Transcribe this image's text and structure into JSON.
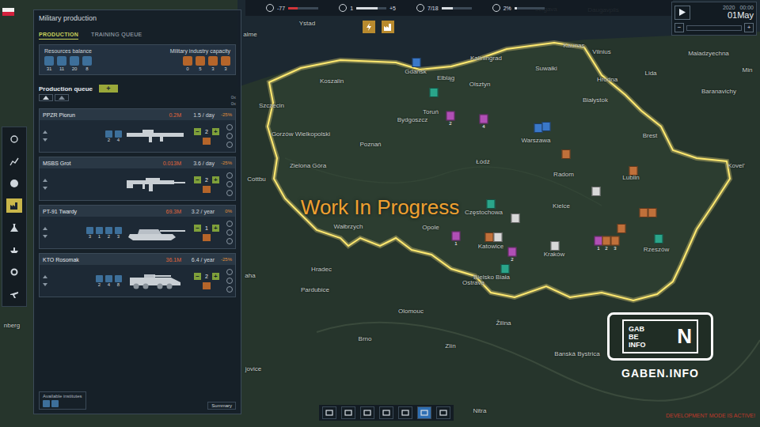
{
  "top_bar": {
    "stats": [
      {
        "label": "-77",
        "level": 0.3,
        "color": "#d0353a"
      },
      {
        "label": "1",
        "delta": "+5",
        "level": 0.72,
        "color": "#d8dde2"
      },
      {
        "label": "7/18",
        "level": 0.39,
        "color": "#d8dde2"
      },
      {
        "label": "2%",
        "level": 0.08,
        "color": "#d8dde2"
      }
    ]
  },
  "date": {
    "year": "2020",
    "time": "00:00",
    "day": "01May",
    "minus": "−",
    "plus": "+",
    "speed_level": 0
  },
  "sidebar": [
    {
      "selected": false
    },
    {
      "selected": false
    },
    {
      "selected": false
    },
    {
      "selected": true
    },
    {
      "selected": false
    },
    {
      "selected": false
    },
    {
      "selected": false
    },
    {
      "selected": false
    }
  ],
  "panel": {
    "title": "Military production",
    "tabs": [
      {
        "label": "PRODUCTION",
        "selected": true
      },
      {
        "label": "TRAINING QUEUE",
        "selected": false
      }
    ],
    "resources": {
      "title": "Resources balance",
      "values": [
        "31",
        "11",
        "20",
        "8"
      ]
    },
    "capacity": {
      "title": "Military industry capacity",
      "values": [
        "0",
        "5",
        "3",
        "3"
      ]
    },
    "queue": {
      "title": "Production queue",
      "add": "+",
      "counts": [
        "0x",
        "0x"
      ]
    },
    "items": [
      {
        "name": "PPZR Piorun",
        "kind": "launcher",
        "cost": "0.2M",
        "rate": "1.5 / day",
        "modifier": "-25%",
        "requirements": [
          "2",
          "4"
        ],
        "quantity": "2",
        "minus": "−",
        "plus": "+"
      },
      {
        "name": "MSBS Grot",
        "kind": "rifle",
        "cost": "0.013M",
        "rate": "3.6 / day",
        "modifier": "-25%",
        "requirements": [],
        "quantity": "2",
        "minus": "−",
        "plus": "+"
      },
      {
        "name": "PT-91 Twardy",
        "kind": "tank",
        "cost": "69.3M",
        "rate": "3.2 / year",
        "modifier": "0%",
        "requirements": [
          "3",
          "1",
          "2",
          "3"
        ],
        "quantity": "1",
        "minus": "−",
        "plus": "+"
      },
      {
        "name": "KTO Rosomak",
        "kind": "apc",
        "cost": "36.1M",
        "rate": "6.4 / year",
        "modifier": "-25%",
        "requirements": [
          "2",
          "4",
          "8"
        ],
        "quantity": "2",
        "minus": "−",
        "plus": "+"
      }
    ],
    "institutes": "Available institutes",
    "summary": "Summary"
  },
  "map": {
    "cities": [
      "Ystad",
      "Jelgava",
      "Daugavpils",
      "Kaliningrad",
      "Kaunas",
      "Vilnius",
      "Maladzyechna",
      "alme",
      "Min",
      "Gdańsk",
      "Elbląg",
      "Olsztyn",
      "Suwałki",
      "Hrodna",
      "Lida",
      "Baranavichy",
      "Koszalin",
      "Białystok",
      "Szczecin",
      "Bydgoszcz",
      "Toruń",
      "Gorzów Wielkopolski",
      "Poznań",
      "Warszawa",
      "Brest",
      "Kovel'",
      "Łódź",
      "Zielona Góra",
      "Radom",
      "Lublin",
      "Cottbu",
      "Kielce",
      "Częstochowa",
      "Opole",
      "Wałbrzych",
      "Katowice",
      "Kraków",
      "Rzeszów",
      "Hradec",
      "aha",
      "Bielsko Biała",
      "Ostrava",
      "Pardubice",
      "Olomouc",
      "Žilina",
      "Brno",
      "Zlín",
      "Banská Bystrica",
      "jovice",
      "nberg",
      "Nitra"
    ],
    "units": [
      {
        "color": "#3a78c8"
      },
      {
        "color": "#2aa58a"
      },
      {
        "color": "#b04fb5",
        "count": "2"
      },
      {
        "color": "#b04fb5",
        "count": "4"
      },
      {
        "color": "#3a78c8"
      },
      {
        "color": "#3a78c8"
      },
      {
        "color": "#c0703a"
      },
      {
        "color": "#c0703a"
      },
      {
        "color": "#d8d8d8"
      },
      {
        "color": "#2aa58a"
      },
      {
        "color": "#d8d8d8"
      },
      {
        "color": "#c0703a"
      },
      {
        "color": "#c0703a"
      },
      {
        "color": "#b04fb5",
        "count": "1"
      },
      {
        "color": "#c0703a"
      },
      {
        "color": "#d8d8d8"
      },
      {
        "color": "#b04fb5",
        "count": "2"
      },
      {
        "color": "#2aa58a"
      },
      {
        "color": "#d8d8d8"
      },
      {
        "color": "#b04fb5",
        "count": "1"
      },
      {
        "color": "#c0703a",
        "count": "2"
      },
      {
        "color": "#c0703a",
        "count": "3"
      },
      {
        "color": "#c0703a"
      },
      {
        "color": "#2aa58a"
      }
    ]
  },
  "overlay": "Work In Progress",
  "bottom_bar": [
    {
      "selected": false
    },
    {
      "selected": false
    },
    {
      "selected": false
    },
    {
      "selected": false
    },
    {
      "selected": false
    },
    {
      "selected": true
    },
    {
      "selected": false
    }
  ],
  "watermark": {
    "small": [
      "GAB",
      "BE",
      "INFO"
    ],
    "big": "N",
    "caption": "GABEN.INFO"
  },
  "dev_mode": "DEVELOPMENT MODE IS ACTIVE!"
}
